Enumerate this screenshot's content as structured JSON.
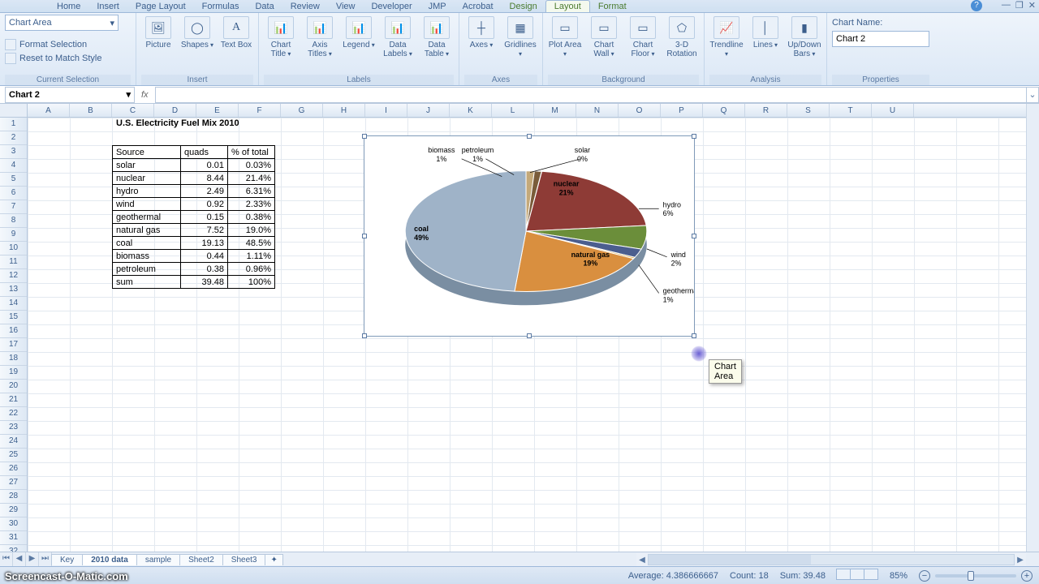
{
  "tabs": {
    "home": "Home",
    "insert": "Insert",
    "page": "Page Layout",
    "formulas": "Formulas",
    "data": "Data",
    "review": "Review",
    "view": "View",
    "developer": "Developer",
    "jmp": "JMP",
    "acrobat": "Acrobat",
    "design": "Design",
    "layout": "Layout",
    "format": "Format"
  },
  "selection": {
    "box": "Chart Area",
    "fmt": "Format Selection",
    "reset": "Reset to Match Style",
    "group": "Current Selection"
  },
  "ins": {
    "picture": "Picture",
    "shapes": "Shapes",
    "textbox": "Text\nBox",
    "group": "Insert"
  },
  "labels": {
    "title": "Chart\nTitle",
    "axis": "Axis\nTitles",
    "legend": "Legend",
    "data": "Data\nLabels",
    "table": "Data\nTable",
    "group": "Labels"
  },
  "axes": {
    "axes": "Axes",
    "grid": "Gridlines",
    "group": "Axes"
  },
  "bg": {
    "plot": "Plot\nArea",
    "wall": "Chart\nWall",
    "floor": "Chart\nFloor",
    "rot": "3-D\nRotation",
    "group": "Background"
  },
  "ana": {
    "trend": "Trendline",
    "lines": "Lines",
    "updown": "Up/Down\nBars",
    "group": "Analysis"
  },
  "props": {
    "namelbl": "Chart Name:",
    "name": "Chart 2",
    "group": "Properties"
  },
  "fbar": {
    "name": "Chart 2"
  },
  "cols": [
    "A",
    "B",
    "C",
    "D",
    "E",
    "F",
    "G",
    "H",
    "I",
    "J",
    "K",
    "L",
    "M",
    "N",
    "O",
    "P",
    "Q",
    "R",
    "S",
    "T",
    "U"
  ],
  "title_cell": "U.S. Electricity Fuel Mix 2010",
  "hdr": {
    "a": "Source",
    "b": "quads",
    "c": "% of total"
  },
  "rows": [
    {
      "s": "solar",
      "q": "0.01",
      "p": "0.03%"
    },
    {
      "s": "nuclear",
      "q": "8.44",
      "p": "21.4%"
    },
    {
      "s": "hydro",
      "q": "2.49",
      "p": "6.31%"
    },
    {
      "s": "wind",
      "q": "0.92",
      "p": "2.33%"
    },
    {
      "s": "geothermal",
      "q": "0.15",
      "p": "0.38%"
    },
    {
      "s": "natural gas",
      "q": "7.52",
      "p": "19.0%"
    },
    {
      "s": "coal",
      "q": "19.13",
      "p": "48.5%"
    },
    {
      "s": "biomass",
      "q": "0.44",
      "p": "1.11%"
    },
    {
      "s": "petroleum",
      "q": "0.38",
      "p": "0.96%"
    }
  ],
  "sum": {
    "s": "sum",
    "q": "39.48",
    "p": "100%"
  },
  "chart_data": {
    "type": "pie",
    "title": "",
    "series": [
      {
        "name": "% of total",
        "values": [
          0.03,
          21.4,
          6.31,
          2.33,
          0.38,
          19.0,
          48.5,
          1.11,
          0.96
        ]
      }
    ],
    "categories": [
      "solar",
      "nuclear",
      "hydro",
      "wind",
      "geothermal",
      "natural gas",
      "coal",
      "biomass",
      "petroleum"
    ],
    "display_labels": [
      {
        "t1": "solar",
        "t2": "0%"
      },
      {
        "t1": "nuclear",
        "t2": "21%"
      },
      {
        "t1": "hydro",
        "t2": "6%"
      },
      {
        "t1": "wind",
        "t2": "2%"
      },
      {
        "t1": "geothermal",
        "t2": "1%"
      },
      {
        "t1": "natural gas",
        "t2": "19%"
      },
      {
        "t1": "coal",
        "t2": "49%"
      },
      {
        "t1": "biomass",
        "t2": "1%"
      },
      {
        "t1": "petroleum",
        "t2": "1%"
      }
    ],
    "colors": {
      "solar": "#f2c178",
      "nuclear": "#8e3b36",
      "hydro": "#6b8e3a",
      "wind": "#4b5e8e",
      "geothermal": "#d9a94a",
      "natural gas": "#d98f3f",
      "coal": "#9fb3c8",
      "biomass": "#c4a97a",
      "petroleum": "#7a5c3a"
    }
  },
  "tooltip": "Chart Area",
  "sheets": {
    "s1": "Key",
    "s2": "2010 data",
    "s3": "sample",
    "s4": "Sheet2",
    "s5": "Sheet3"
  },
  "status": {
    "avg": "Average: 4.386666667",
    "cnt": "Count: 18",
    "sum": "Sum: 39.48",
    "zoom": "85%"
  },
  "watermark": "Screencast-O-Matic.com"
}
